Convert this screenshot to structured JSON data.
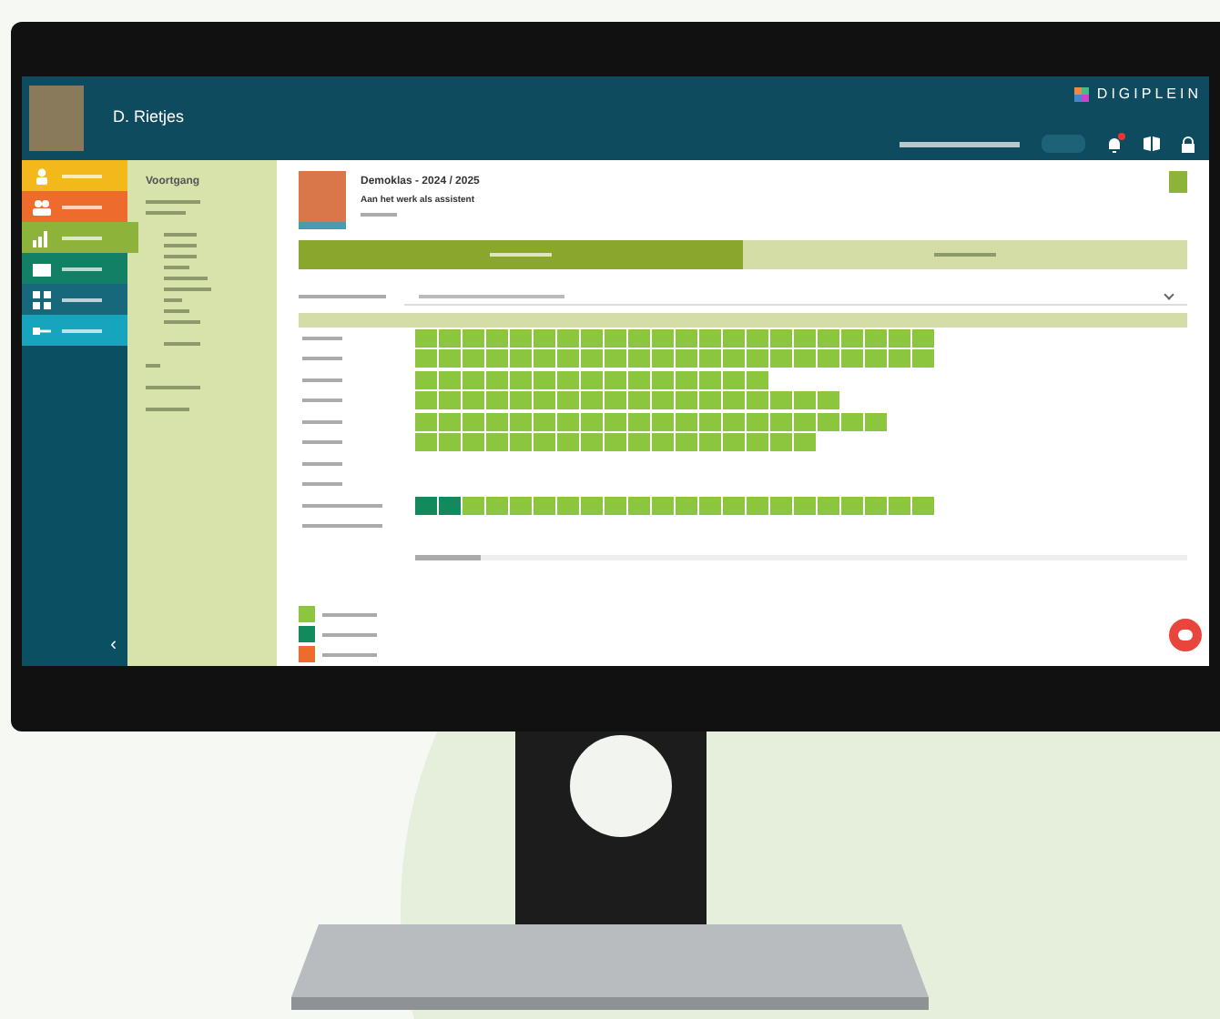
{
  "header": {
    "user_name": "D. Rietjes",
    "brand": "DIGIPLEIN",
    "notification_badge": true
  },
  "nav": {
    "items": [
      {
        "color": "#f2b81c",
        "kind": "person",
        "selected": false
      },
      {
        "color": "#ec6b2d",
        "kind": "people",
        "selected": false
      },
      {
        "color": "#8db33a",
        "kind": "chart",
        "selected": true
      },
      {
        "color": "#128064",
        "kind": "mail",
        "selected": false
      },
      {
        "color": "#17687a",
        "kind": "grid",
        "selected": false
      },
      {
        "color": "#17a5bd",
        "kind": "key",
        "selected": false
      }
    ],
    "collapse_label": "‹"
  },
  "panel": {
    "title": "Voortgang"
  },
  "course": {
    "title": "Demoklas - 2024 / 2025",
    "subtitle": "Aan het werk als assistent"
  },
  "tabs": [
    {
      "selected": true
    },
    {
      "selected": false
    }
  ],
  "table": {
    "rows": [
      {
        "cells": [
          {
            "kind": "done"
          },
          {
            "kind": "done"
          },
          {
            "kind": "done"
          },
          {
            "kind": "done"
          },
          {
            "kind": "done"
          },
          {
            "kind": "done"
          },
          {
            "kind": "done"
          },
          {
            "kind": "done"
          },
          {
            "kind": "done"
          },
          {
            "kind": "done"
          },
          {
            "kind": "done"
          },
          {
            "kind": "done"
          },
          {
            "kind": "done"
          },
          {
            "kind": "done"
          },
          {
            "kind": "done"
          },
          {
            "kind": "done"
          },
          {
            "kind": "done"
          },
          {
            "kind": "done"
          },
          {
            "kind": "done"
          },
          {
            "kind": "done"
          },
          {
            "kind": "done"
          },
          {
            "kind": "done"
          }
        ]
      },
      {
        "cells": [
          {
            "kind": "done"
          },
          {
            "kind": "done"
          },
          {
            "kind": "done"
          },
          {
            "kind": "done"
          },
          {
            "kind": "done"
          },
          {
            "kind": "done"
          },
          {
            "kind": "done"
          },
          {
            "kind": "done"
          },
          {
            "kind": "done"
          },
          {
            "kind": "done"
          },
          {
            "kind": "done"
          },
          {
            "kind": "done"
          },
          {
            "kind": "done"
          },
          {
            "kind": "done"
          },
          {
            "kind": "done"
          },
          {
            "kind": "done"
          },
          {
            "kind": "done"
          },
          {
            "kind": "done"
          },
          {
            "kind": "done"
          },
          {
            "kind": "done"
          },
          {
            "kind": "done"
          },
          {
            "kind": "done"
          }
        ]
      },
      {
        "cells": [
          {
            "kind": "done"
          },
          {
            "kind": "done"
          },
          {
            "kind": "done"
          },
          {
            "kind": "done"
          },
          {
            "kind": "done"
          },
          {
            "kind": "done"
          },
          {
            "kind": "done"
          },
          {
            "kind": "done"
          },
          {
            "kind": "done"
          },
          {
            "kind": "done"
          },
          {
            "kind": "done"
          },
          {
            "kind": "done"
          },
          {
            "kind": "done"
          },
          {
            "kind": "done"
          },
          {
            "kind": "done"
          }
        ]
      },
      {
        "cells": [
          {
            "kind": "done"
          },
          {
            "kind": "done"
          },
          {
            "kind": "done"
          },
          {
            "kind": "done"
          },
          {
            "kind": "done"
          },
          {
            "kind": "done"
          },
          {
            "kind": "done"
          },
          {
            "kind": "done"
          },
          {
            "kind": "done"
          },
          {
            "kind": "done"
          },
          {
            "kind": "done"
          },
          {
            "kind": "done"
          },
          {
            "kind": "done"
          },
          {
            "kind": "done"
          },
          {
            "kind": "done"
          },
          {
            "kind": "done"
          },
          {
            "kind": "done"
          },
          {
            "kind": "done"
          }
        ]
      },
      {
        "cells": [
          {
            "kind": "done"
          },
          {
            "kind": "done"
          },
          {
            "kind": "done"
          },
          {
            "kind": "done"
          },
          {
            "kind": "done"
          },
          {
            "kind": "done"
          },
          {
            "kind": "done"
          },
          {
            "kind": "done"
          },
          {
            "kind": "done"
          },
          {
            "kind": "done"
          },
          {
            "kind": "done"
          },
          {
            "kind": "done"
          },
          {
            "kind": "done"
          },
          {
            "kind": "done"
          },
          {
            "kind": "done"
          },
          {
            "kind": "done"
          },
          {
            "kind": "done"
          },
          {
            "kind": "done"
          },
          {
            "kind": "done"
          },
          {
            "kind": "done"
          }
        ]
      },
      {
        "cells": [
          {
            "kind": "done"
          },
          {
            "kind": "done"
          },
          {
            "kind": "done"
          },
          {
            "kind": "done"
          },
          {
            "kind": "done"
          },
          {
            "kind": "done"
          },
          {
            "kind": "done"
          },
          {
            "kind": "done"
          },
          {
            "kind": "done"
          },
          {
            "kind": "done"
          },
          {
            "kind": "done"
          },
          {
            "kind": "done"
          },
          {
            "kind": "done"
          },
          {
            "kind": "done"
          },
          {
            "kind": "done"
          },
          {
            "kind": "done"
          },
          {
            "kind": "done"
          }
        ]
      },
      {},
      {},
      {
        "cells": [
          {
            "kind": "checked"
          },
          {
            "kind": "checked"
          },
          {
            "kind": "done"
          },
          {
            "kind": "done"
          },
          {
            "kind": "done"
          },
          {
            "kind": "done"
          },
          {
            "kind": "done"
          },
          {
            "kind": "done"
          },
          {
            "kind": "done"
          },
          {
            "kind": "done"
          },
          {
            "kind": "done"
          },
          {
            "kind": "done"
          },
          {
            "kind": "done"
          },
          {
            "kind": "done"
          },
          {
            "kind": "done"
          },
          {
            "kind": "done"
          },
          {
            "kind": "done"
          },
          {
            "kind": "done"
          },
          {
            "kind": "done"
          },
          {
            "kind": "done"
          },
          {
            "kind": "done"
          },
          {
            "kind": "done"
          }
        ]
      },
      {}
    ]
  },
  "legend": [
    {
      "color": "#8cc63f"
    },
    {
      "color": "#138a5e"
    },
    {
      "color": "#ec6b2d"
    }
  ]
}
